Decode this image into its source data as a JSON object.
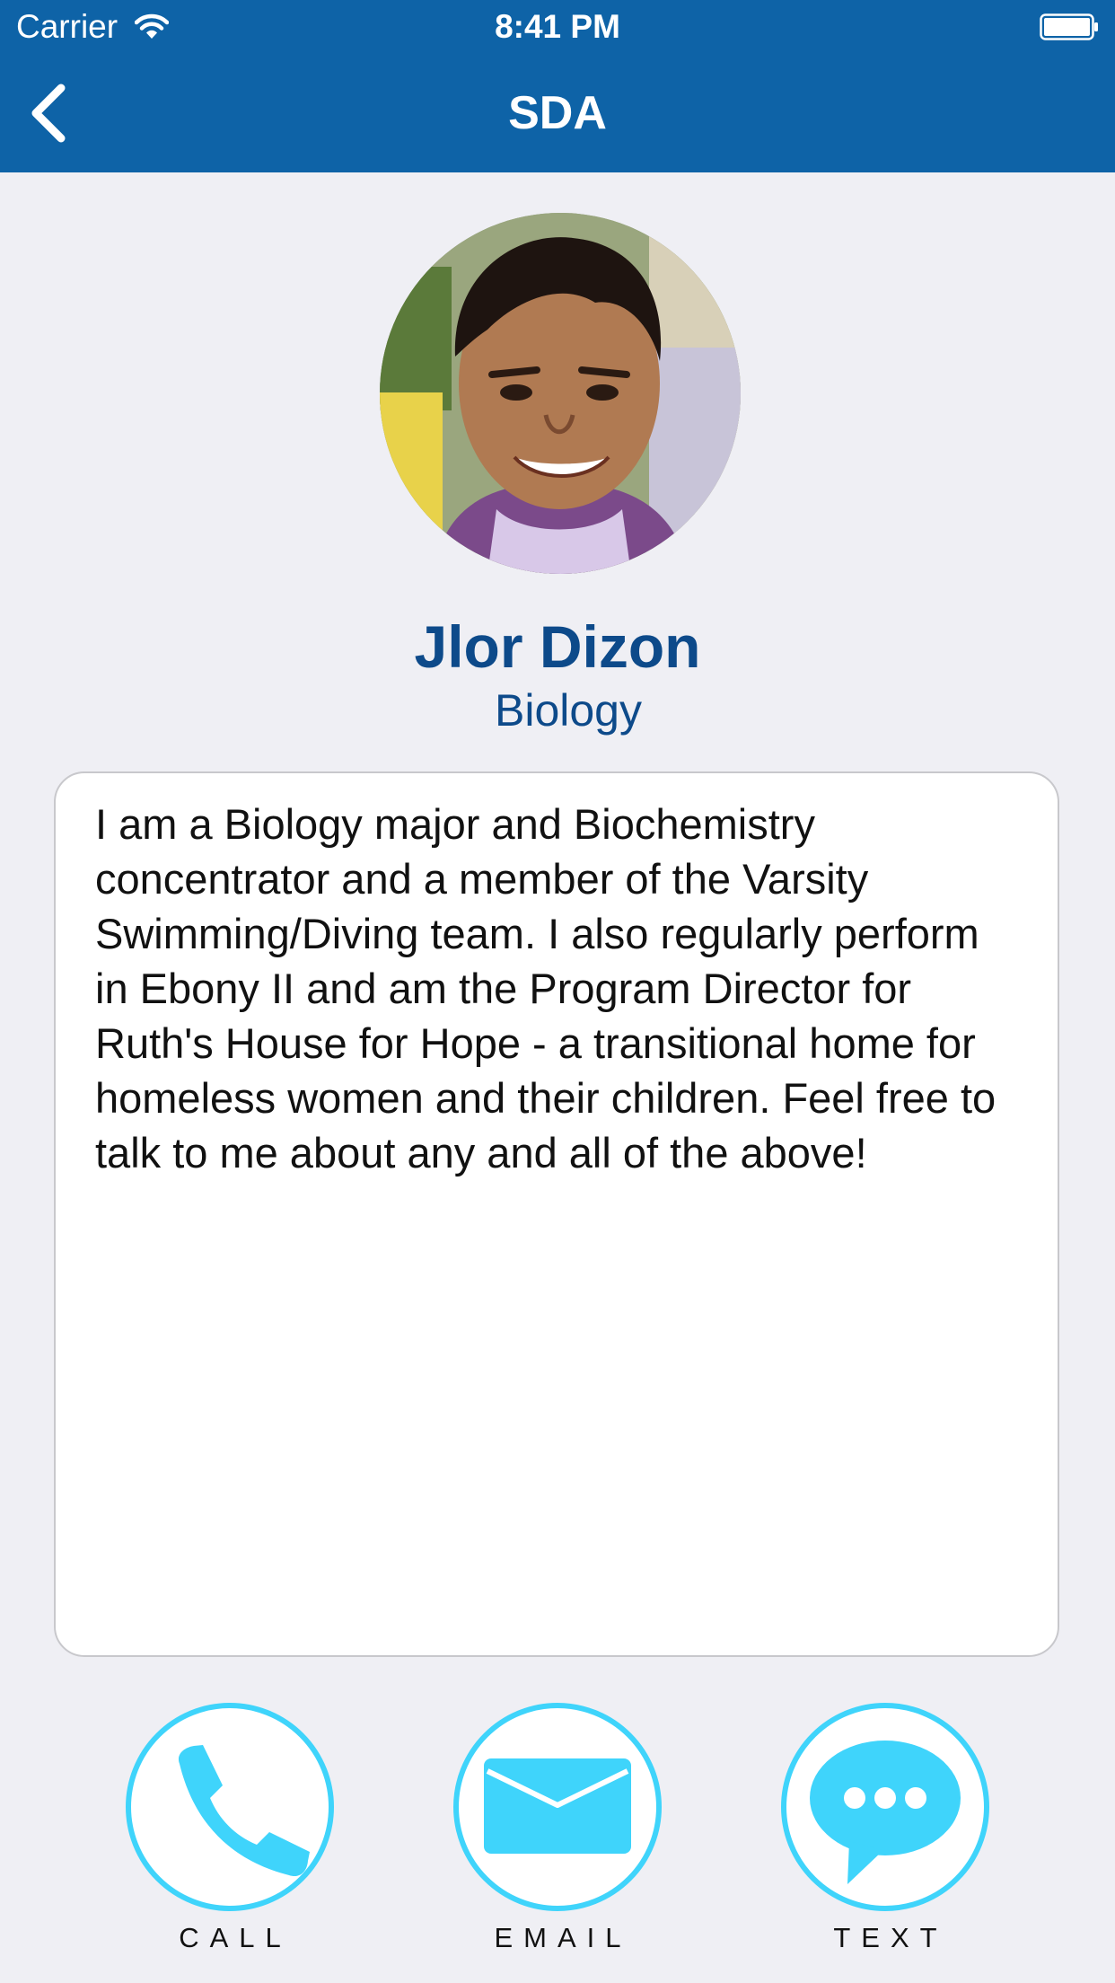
{
  "status_bar": {
    "carrier": "Carrier",
    "time": "8:41 PM"
  },
  "nav": {
    "title": "SDA"
  },
  "profile": {
    "name": "Jlor Dizon",
    "major": "Biology",
    "bio": "I am a Biology major and Biochemistry concentrator and a member of the Varsity Swimming/Diving team. I also regularly perform in Ebony II and am the Program Director for Ruth's House for Hope - a transitional home for homeless women and their children. Feel free to talk to me about any and all of the above!"
  },
  "actions": {
    "call_label": "CALL",
    "email_label": "EMAIL",
    "text_label": "TEXT"
  },
  "colors": {
    "nav_background": "#0e63a7",
    "name_text": "#0d4a8a",
    "action_accent": "#3fd4fb",
    "page_background": "#efeff4"
  },
  "icons": {
    "back": "chevron-left-icon",
    "call": "phone-icon",
    "email": "envelope-icon",
    "text": "chat-bubble-icon"
  }
}
